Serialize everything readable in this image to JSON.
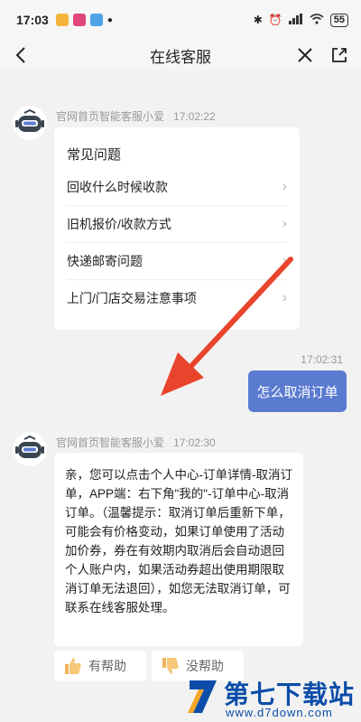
{
  "status_bar": {
    "time": "17:03",
    "battery": "55"
  },
  "nav": {
    "title": "在线客服"
  },
  "messages": {
    "bot1": {
      "sender": "官网首页智能客服小爱",
      "time": "17:02:22"
    },
    "faq": {
      "title": "常见问题",
      "items": [
        "回收什么时候收款",
        "旧机报价/收款方式",
        "快递邮寄问题",
        "上门/门店交易注意事项"
      ]
    },
    "user": {
      "time": "17:02:31",
      "text": "怎么取消订单"
    },
    "bot2": {
      "sender": "官网首页智能客服小爱",
      "time": "17:02:30",
      "text": "亲，您可以点击个人中心-订单详情-取消订单，APP端：右下角\"我的\"-订单中心-取消订单。（温馨提示：取消订单后重新下单，可能会有价格变动，如果订单使用了活动加价券，券在有效期内取消后会自动退回个人账户内，如果活动券超出使用期限取消订单无法退回），如您无法取消订单，可联系在线客服处理。"
    },
    "feedback": {
      "helpful": "有帮助",
      "unhelpful": "没帮助"
    }
  },
  "watermark": {
    "title": "第七下载站",
    "url": "www.d7down.com"
  },
  "colors": {
    "accent": "#5b7bd0",
    "arrow": "#e8452c",
    "watermark": "#0b4da8"
  }
}
